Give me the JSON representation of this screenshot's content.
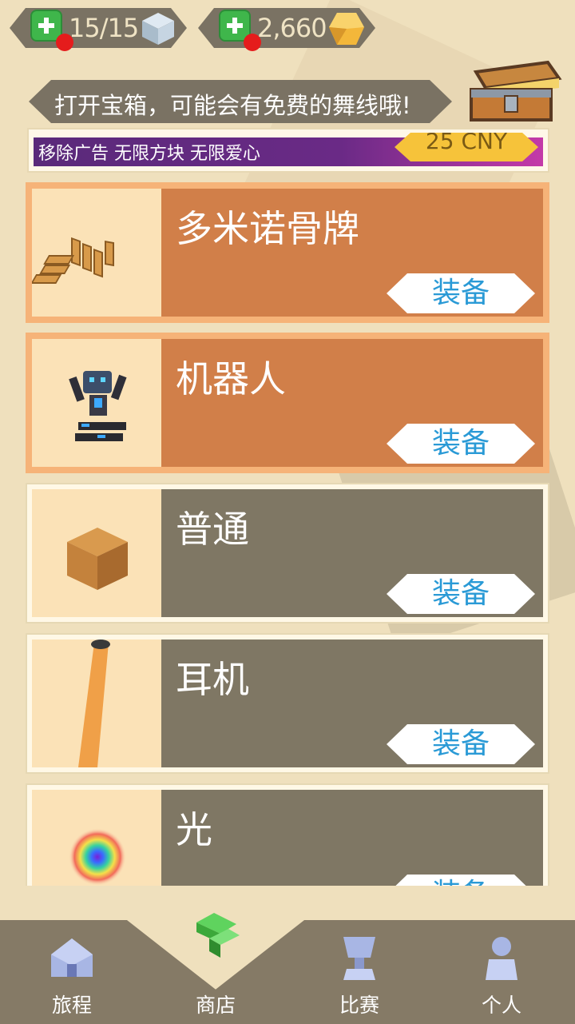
{
  "currency": {
    "hearts": "15/15",
    "gems": "2,660"
  },
  "banner": {
    "text": "打开宝箱，可能会有免费的舞线哦!"
  },
  "promo": {
    "text": "移除广告  无限方块  无限爱心",
    "price": "25 CNY"
  },
  "equip_label": "装备",
  "items": [
    {
      "name": "多米诺骨牌",
      "selected": true
    },
    {
      "name": "机器人",
      "selected": true
    },
    {
      "name": "普通",
      "selected": false
    },
    {
      "name": "耳机",
      "selected": false
    },
    {
      "name": "光",
      "selected": false
    }
  ],
  "nav": {
    "tabs": [
      {
        "label": "旅程",
        "icon": "house-icon"
      },
      {
        "label": "商店",
        "icon": "shop-icon"
      },
      {
        "label": "比赛",
        "icon": "trophy-icon"
      },
      {
        "label": "个人",
        "icon": "person-icon"
      }
    ]
  },
  "colors": {
    "background": "#efe0bd",
    "selected_card": "#d17f49",
    "normal_card": "#7f7764",
    "equip_text": "#2a9ad6",
    "nav_bg": "#857a66"
  }
}
